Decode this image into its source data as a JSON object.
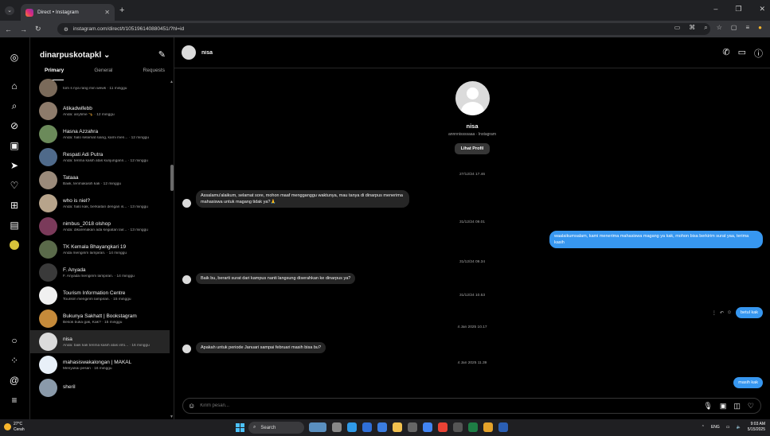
{
  "browser": {
    "tab_title": "Direct • Instagram",
    "url": "instagram.com/direct/t/105196140880451/?hl=id"
  },
  "inbox": {
    "account": "dinarpuskotapkl",
    "tabs": [
      "Primary",
      "General",
      "Requests"
    ],
    "threads": [
      {
        "name": "",
        "preview": "tom s nya rang min wewk · 11 minggu",
        "color": "#7a6a5a"
      },
      {
        "name": "Atikadwifebb",
        "preview": "Anda: anytime 🤸 · 12 minggu",
        "color": "#8d7b6b"
      },
      {
        "name": "Hasna Azzahra",
        "preview": "Anda: halo selamat siang, kami men... · 12 minggu",
        "color": "#6b8a5a"
      },
      {
        "name": "Respati Adi Putra",
        "preview": "Anda: terima kasih atas kunjungann... · 12 minggu",
        "color": "#4f6a8a"
      },
      {
        "name": "Tataaa",
        "preview": "Baiik, terimakasih kak · 12 minggu",
        "color": "#9a8a7a"
      },
      {
        "name": "who is niel?",
        "preview": "Anda: halo kak, berkaitan dengan is... · 13 minggu",
        "color": "#b7a48b"
      },
      {
        "name": "nimbus_2018 olshop",
        "preview": "Anda: dikarenakan ada kegiatan lair... · 13 minggu",
        "color": "#7a3a5a"
      },
      {
        "name": "TK Kemala Bhayangkari 19",
        "preview": "Anda mengirim lampiran. · 14 minggu",
        "color": "#5a6a4a"
      },
      {
        "name": "F. Anyada",
        "preview": "F. Anyada mengirim lampiran. · 14 minggu",
        "color": "#3a3a3a"
      },
      {
        "name": "Tourism Information Centre",
        "preview": "Tourism mengirim lampiran. · 15 minggu",
        "color": "#f0f0f0"
      },
      {
        "name": "Bukunya Sakhatt | Bookstagram",
        "preview": "Besok buka gak, Kak? · 15 minggu",
        "color": "#c58a3a"
      },
      {
        "name": "nisa",
        "preview": "Anda: baik kak terima kasih atas info... · 16 minggu",
        "color": "#dbdbdb",
        "selected": true
      },
      {
        "name": "mahasiswakalongan | MAKAL",
        "preview": "Menyukai pesan · 16 minggu",
        "color": "#e8f0f8"
      },
      {
        "name": "sheril",
        "preview": "",
        "color": "#8a9aaa"
      }
    ]
  },
  "chat": {
    "name": "nisa",
    "profile_name": "nisa",
    "profile_sub": "annnnissssaaa · Instagram",
    "profile_button": "Lihat Profil",
    "messages": [
      {
        "kind": "ts",
        "text": "27/12/24 17.46"
      },
      {
        "kind": "in",
        "text": "Assalamu'alaikum, selamat sore, mohon maaf mengganggu waktunya, mau tanya di dinarpus menerima mahasiswa untuk magang tidak ya?🙏"
      },
      {
        "kind": "ts",
        "text": "31/12/24 09.01"
      },
      {
        "kind": "out",
        "text": "waalaikumsalam, kami menerima mahasiswa magang ya kak, mohon bisa berkirim surat yaa, terima kasih"
      },
      {
        "kind": "ts",
        "text": "31/12/24 09.34"
      },
      {
        "kind": "in",
        "text": "Baik bu, berarti surat dari kampus nanti langsung diserahkan ke dinarpus ya?"
      },
      {
        "kind": "ts",
        "text": "31/12/24 10.53"
      },
      {
        "kind": "out",
        "text": "betul kak"
      },
      {
        "kind": "ts",
        "text": "4 Jan 2025 10.17"
      },
      {
        "kind": "in",
        "text": "Apakah untuk periode Januari sampai februari masih bisa bu?"
      },
      {
        "kind": "ts",
        "text": "4 Jan 2025 11.39"
      },
      {
        "kind": "out",
        "text": "masih kak"
      }
    ],
    "composer_placeholder": "Kirim pesan..."
  },
  "taskbar": {
    "temp": "27°C",
    "weather": "Cerah",
    "search": "Search",
    "lang": "ENG",
    "time": "9:03 AM",
    "date": "5/15/2025"
  }
}
